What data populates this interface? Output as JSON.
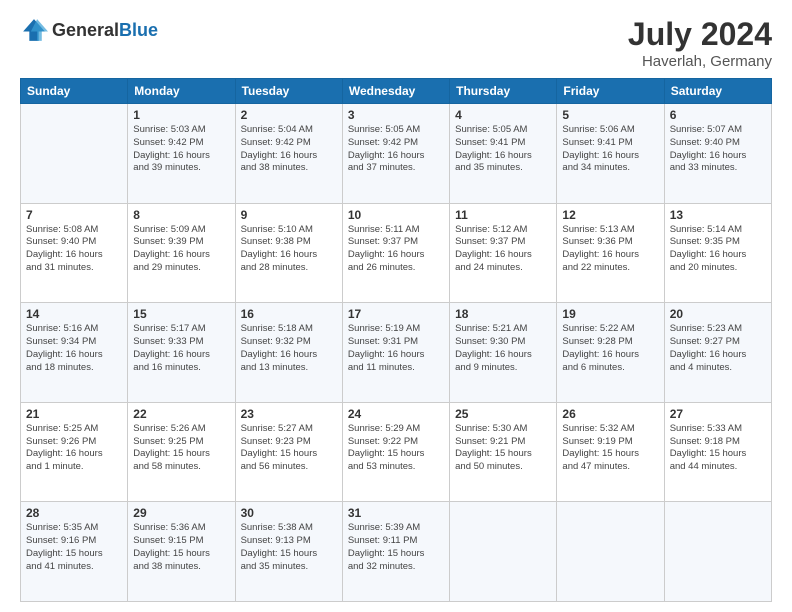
{
  "header": {
    "logo_general": "General",
    "logo_blue": "Blue",
    "month_year": "July 2024",
    "location": "Haverlah, Germany"
  },
  "days_of_week": [
    "Sunday",
    "Monday",
    "Tuesday",
    "Wednesday",
    "Thursday",
    "Friday",
    "Saturday"
  ],
  "weeks": [
    [
      {
        "day": "",
        "info": ""
      },
      {
        "day": "1",
        "info": "Sunrise: 5:03 AM\nSunset: 9:42 PM\nDaylight: 16 hours\nand 39 minutes."
      },
      {
        "day": "2",
        "info": "Sunrise: 5:04 AM\nSunset: 9:42 PM\nDaylight: 16 hours\nand 38 minutes."
      },
      {
        "day": "3",
        "info": "Sunrise: 5:05 AM\nSunset: 9:42 PM\nDaylight: 16 hours\nand 37 minutes."
      },
      {
        "day": "4",
        "info": "Sunrise: 5:05 AM\nSunset: 9:41 PM\nDaylight: 16 hours\nand 35 minutes."
      },
      {
        "day": "5",
        "info": "Sunrise: 5:06 AM\nSunset: 9:41 PM\nDaylight: 16 hours\nand 34 minutes."
      },
      {
        "day": "6",
        "info": "Sunrise: 5:07 AM\nSunset: 9:40 PM\nDaylight: 16 hours\nand 33 minutes."
      }
    ],
    [
      {
        "day": "7",
        "info": "Sunrise: 5:08 AM\nSunset: 9:40 PM\nDaylight: 16 hours\nand 31 minutes."
      },
      {
        "day": "8",
        "info": "Sunrise: 5:09 AM\nSunset: 9:39 PM\nDaylight: 16 hours\nand 29 minutes."
      },
      {
        "day": "9",
        "info": "Sunrise: 5:10 AM\nSunset: 9:38 PM\nDaylight: 16 hours\nand 28 minutes."
      },
      {
        "day": "10",
        "info": "Sunrise: 5:11 AM\nSunset: 9:37 PM\nDaylight: 16 hours\nand 26 minutes."
      },
      {
        "day": "11",
        "info": "Sunrise: 5:12 AM\nSunset: 9:37 PM\nDaylight: 16 hours\nand 24 minutes."
      },
      {
        "day": "12",
        "info": "Sunrise: 5:13 AM\nSunset: 9:36 PM\nDaylight: 16 hours\nand 22 minutes."
      },
      {
        "day": "13",
        "info": "Sunrise: 5:14 AM\nSunset: 9:35 PM\nDaylight: 16 hours\nand 20 minutes."
      }
    ],
    [
      {
        "day": "14",
        "info": "Sunrise: 5:16 AM\nSunset: 9:34 PM\nDaylight: 16 hours\nand 18 minutes."
      },
      {
        "day": "15",
        "info": "Sunrise: 5:17 AM\nSunset: 9:33 PM\nDaylight: 16 hours\nand 16 minutes."
      },
      {
        "day": "16",
        "info": "Sunrise: 5:18 AM\nSunset: 9:32 PM\nDaylight: 16 hours\nand 13 minutes."
      },
      {
        "day": "17",
        "info": "Sunrise: 5:19 AM\nSunset: 9:31 PM\nDaylight: 16 hours\nand 11 minutes."
      },
      {
        "day": "18",
        "info": "Sunrise: 5:21 AM\nSunset: 9:30 PM\nDaylight: 16 hours\nand 9 minutes."
      },
      {
        "day": "19",
        "info": "Sunrise: 5:22 AM\nSunset: 9:28 PM\nDaylight: 16 hours\nand 6 minutes."
      },
      {
        "day": "20",
        "info": "Sunrise: 5:23 AM\nSunset: 9:27 PM\nDaylight: 16 hours\nand 4 minutes."
      }
    ],
    [
      {
        "day": "21",
        "info": "Sunrise: 5:25 AM\nSunset: 9:26 PM\nDaylight: 16 hours\nand 1 minute."
      },
      {
        "day": "22",
        "info": "Sunrise: 5:26 AM\nSunset: 9:25 PM\nDaylight: 15 hours\nand 58 minutes."
      },
      {
        "day": "23",
        "info": "Sunrise: 5:27 AM\nSunset: 9:23 PM\nDaylight: 15 hours\nand 56 minutes."
      },
      {
        "day": "24",
        "info": "Sunrise: 5:29 AM\nSunset: 9:22 PM\nDaylight: 15 hours\nand 53 minutes."
      },
      {
        "day": "25",
        "info": "Sunrise: 5:30 AM\nSunset: 9:21 PM\nDaylight: 15 hours\nand 50 minutes."
      },
      {
        "day": "26",
        "info": "Sunrise: 5:32 AM\nSunset: 9:19 PM\nDaylight: 15 hours\nand 47 minutes."
      },
      {
        "day": "27",
        "info": "Sunrise: 5:33 AM\nSunset: 9:18 PM\nDaylight: 15 hours\nand 44 minutes."
      }
    ],
    [
      {
        "day": "28",
        "info": "Sunrise: 5:35 AM\nSunset: 9:16 PM\nDaylight: 15 hours\nand 41 minutes."
      },
      {
        "day": "29",
        "info": "Sunrise: 5:36 AM\nSunset: 9:15 PM\nDaylight: 15 hours\nand 38 minutes."
      },
      {
        "day": "30",
        "info": "Sunrise: 5:38 AM\nSunset: 9:13 PM\nDaylight: 15 hours\nand 35 minutes."
      },
      {
        "day": "31",
        "info": "Sunrise: 5:39 AM\nSunset: 9:11 PM\nDaylight: 15 hours\nand 32 minutes."
      },
      {
        "day": "",
        "info": ""
      },
      {
        "day": "",
        "info": ""
      },
      {
        "day": "",
        "info": ""
      }
    ]
  ]
}
